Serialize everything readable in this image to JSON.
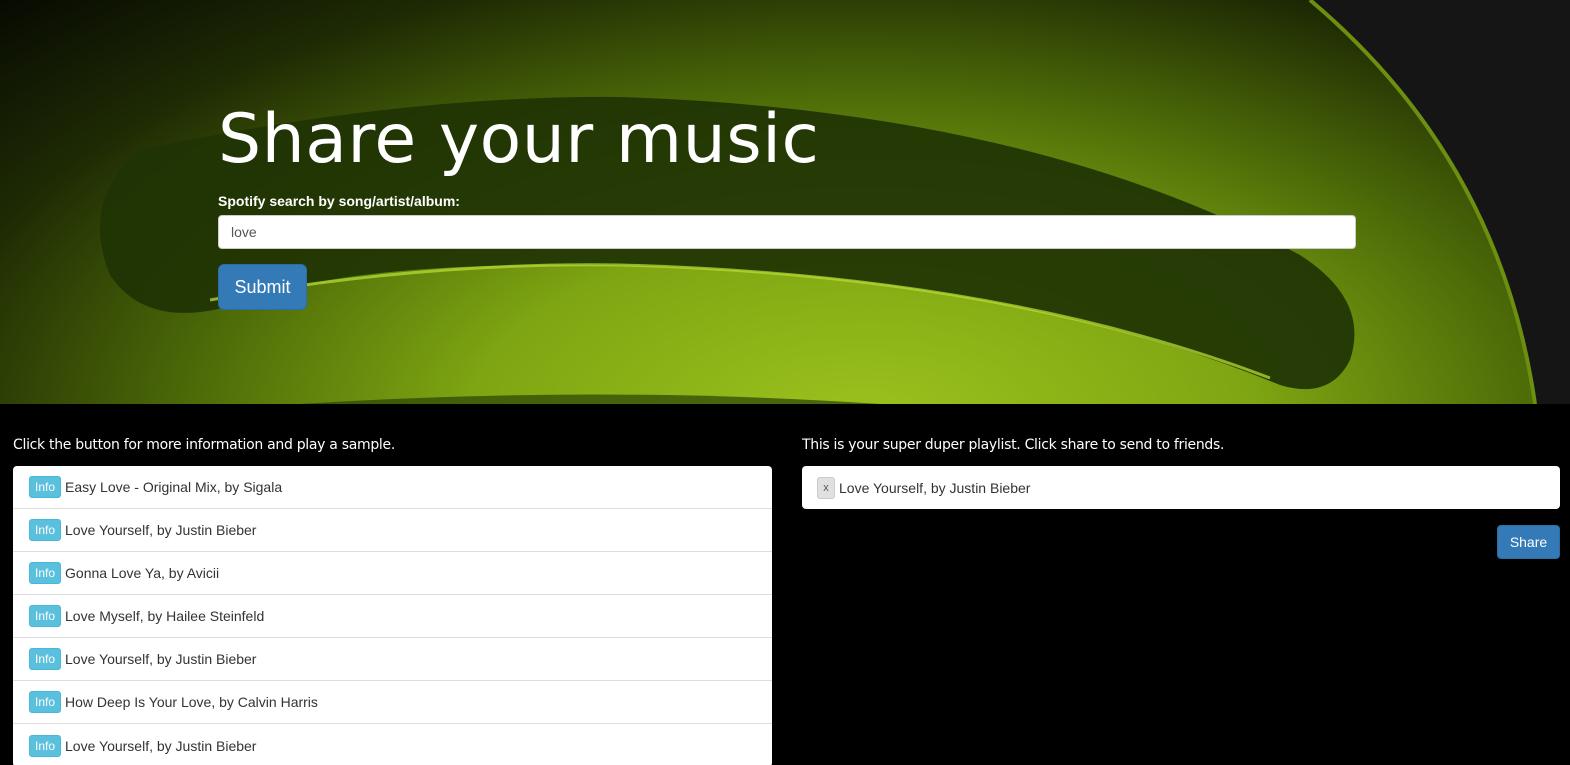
{
  "hero": {
    "title": "Share your music",
    "search_label": "Spotify search by song/artist/album:",
    "search_value": "love",
    "submit_label": "Submit"
  },
  "results": {
    "caption": "Click the button for more information and play a sample.",
    "info_label": "Info",
    "items": [
      {
        "text": "Easy Love - Original Mix, by Sigala"
      },
      {
        "text": "Love Yourself, by Justin Bieber"
      },
      {
        "text": "Gonna Love Ya, by Avicii"
      },
      {
        "text": "Love Myself, by Hailee Steinfeld"
      },
      {
        "text": "Love Yourself, by Justin Bieber"
      },
      {
        "text": "How Deep Is Your Love, by Calvin Harris"
      },
      {
        "text": "Love Yourself, by Justin Bieber"
      }
    ]
  },
  "playlist": {
    "caption": "This is your super duper playlist. Click share to send to friends.",
    "remove_label": "x",
    "items": [
      {
        "text": "Love Yourself, by Justin Bieber"
      }
    ],
    "share_label": "Share"
  },
  "colors": {
    "accent_green": "#8cb81a",
    "primary_blue": "#337ab7",
    "info_blue": "#5bc0de"
  }
}
